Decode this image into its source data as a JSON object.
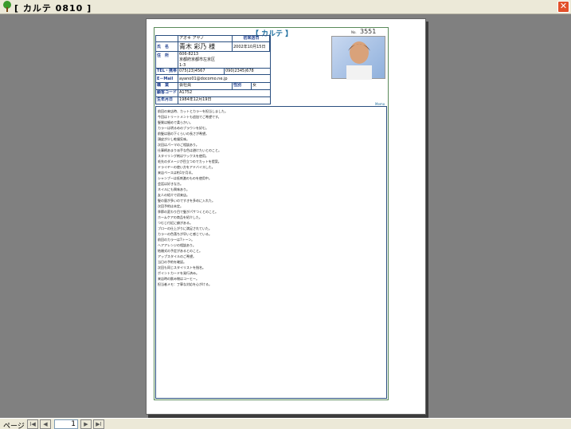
{
  "window": {
    "title": "[ カルテ 0810 ]",
    "close_glyph": "✕"
  },
  "document": {
    "title": "【 カルテ 】",
    "no_label": "No.",
    "no_value": "3551",
    "memo_label": "Memo",
    "info": {
      "furigana_label": "フリガナ",
      "furigana": "アオキ アヤノ",
      "first_visit_label": "初来店日",
      "name_label": "氏　名",
      "name": "青木 彩乃 様",
      "first_visit": "2002年10月15日",
      "postal_label": "〒",
      "postal": "606-8213",
      "address_label": "住　所",
      "address": "京都府京都市左京区",
      "address2": "1-3",
      "tel_label": "TEL・携帯",
      "tel": "075(23)4567",
      "mobile": "090(2345)678",
      "email_label": "E－Mail",
      "email": "ayano01@docomo.ne.jp",
      "job_label": "職　業",
      "job": "会社員",
      "sex_label": "性別",
      "sex": "女",
      "ref_label": "顧客コード",
      "ref": "A1752",
      "dob_label": "生年月日",
      "dob": "1984年12月19日"
    },
    "memo_lines": [
      "前回の来店時、カットとカラーを担当しました。",
      "今回はトリートメントも追加でご希望です。",
      "髪質は細めで柔らかい。",
      "カラーは明るめのブラウンを好む。",
      "前髪は眉の下くらいの長さが希望。",
      "頭皮が少し乾燥気味。",
      "次回はパーマのご相談あり。",
      "仕事柄あまり派手な色は避けたいとのこと。",
      "スタイリング剤はワックスを使用。",
      "毛先のダメージが目立つのでカットを提案。",
      "ドライヤーの使い方をアドバイスした。",
      "来店ペースは約1か月半。",
      "シャンプーは低刺激のものを使用中。",
      "会話は好きな方。",
      "ネイルにも興味あり。",
      "友人の紹介で初来店。",
      "髪の量が多いのですきを多めに入れた。",
      "次回予約は未定。",
      "季節の変わり目で髪がパサつくとのこと。",
      "ホームケアの商品を紹介した。",
      "つむじ付近に癖がある。",
      "ブローの仕上がりに満足されていた。",
      "カラーの色落ちが早いと感じている。",
      "前回のカラーは7トーン。",
      "ヘアアレンジの相談あり。",
      "結婚式の予定があるとのこと。",
      "アップスタイルのご希望。",
      "当日の予約を確認。",
      "次回も同じスタイリストを指名。",
      "ポイントカードを発行済み。",
      "来店時の飲み物はコーヒー。",
      "担当者メモ：丁寧な対応を心がける。"
    ]
  },
  "statusbar": {
    "page_label": "ページ",
    "first_btn": "I◀",
    "prev_btn": "◀",
    "page_value": "1",
    "next_btn": "▶",
    "last_btn": "▶I"
  }
}
